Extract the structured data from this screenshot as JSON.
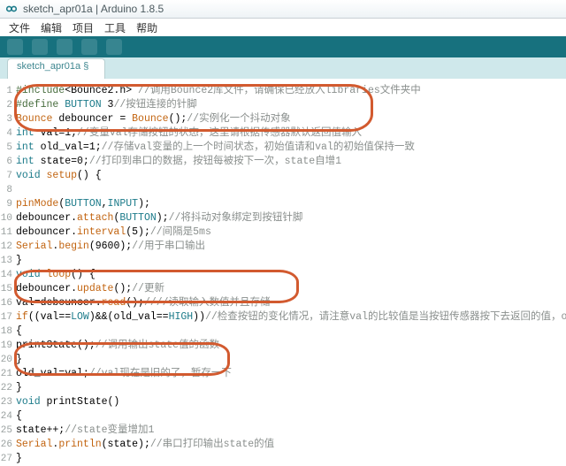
{
  "window": {
    "title": "sketch_apr01a | Arduino 1.8.5"
  },
  "menu": {
    "file": "文件",
    "edit": "编辑",
    "project": "项目",
    "tools": "工具",
    "help": "帮助"
  },
  "tabs": {
    "main": "sketch_apr01a §"
  },
  "code": {
    "lines": [
      {
        "n": "1",
        "html": "<span class='kw-inc'>#include</span>&lt;Bounce2.h&gt; <span class='cmt'>//调用Bounce2库文件，请确保已经放入libraries文件夹中</span>"
      },
      {
        "n": "2",
        "html": "<span class='kw-def'>#define</span> <span class='mac'>BUTTON</span> 3<span class='cmt'>//按钮连接的针脚</span>"
      },
      {
        "n": "3",
        "html": "<span class='cls'>Bounce</span> debouncer = <span class='cls'>Bounce</span>();<span class='cmt'>//实例化一个抖动对象</span>"
      },
      {
        "n": "4",
        "html": "<span class='kw-type'>int</span> val=1;<span class='cmt'>//变量val存储按钮的状态，这里请根据传感器默认返回值输入</span>"
      },
      {
        "n": "5",
        "html": "<span class='kw-type'>int</span> old_val=1;<span class='cmt'>//存储val变量的上一个时间状态，初始值请和val的初始值保持一致</span>"
      },
      {
        "n": "6",
        "html": "<span class='kw-type'>int</span> state=0;<span class='cmt'>//打印到串口的数据，按钮每被按下一次，state自增1</span>"
      },
      {
        "n": "7",
        "html": "<span class='kw-void'>void</span> <span class='fn'>setup</span>() {"
      },
      {
        "n": "8",
        "html": ""
      },
      {
        "n": "9",
        "html": "<span class='fn'>pinMode</span>(<span class='mac'>BUTTON</span>,<span class='mac'>INPUT</span>);"
      },
      {
        "n": "10",
        "html": "debouncer.<span class='fn'>attach</span>(<span class='mac'>BUTTON</span>);<span class='cmt'>//将抖动对象绑定到按钮针脚</span>"
      },
      {
        "n": "11",
        "html": "debouncer.<span class='fn'>interval</span>(5);<span class='cmt'>//间隔是5ms</span>"
      },
      {
        "n": "12",
        "html": "<span class='cls'>Serial</span>.<span class='fn'>begin</span>(9600);<span class='cmt'>//用于串口输出</span>"
      },
      {
        "n": "13",
        "html": "}"
      },
      {
        "n": "14",
        "html": "<span class='kw-void'>void</span> <span class='fn'>loop</span>() {"
      },
      {
        "n": "15",
        "html": "debouncer.<span class='fn'>update</span>();<span class='cmt'>//更新</span>"
      },
      {
        "n": "16",
        "html": "val=debouncer.<span class='fn'>read</span>();<span class='cmt'>////读取输入数值并且存储</span>"
      },
      {
        "n": "17",
        "html": "<span class='fn'>if</span>((val==<span class='mac'>LOW</span>)&&(old_val==<span class='mac'>HIGH</span>))<span class='cmt'>//检查按钮的变化情况，请注意val的比较值是当按钮传感器按下去返回的值，old_val和val相反即可。</span>"
      },
      {
        "n": "18",
        "html": "{"
      },
      {
        "n": "19",
        "html": "printState();<span class='cmt'>//调用输出state值的函数</span>"
      },
      {
        "n": "20",
        "html": "}"
      },
      {
        "n": "21",
        "html": "old_val=val;<span class='cmt'>//val现在是旧的了，暂存一下</span>"
      },
      {
        "n": "22",
        "html": "}"
      },
      {
        "n": "23",
        "html": "<span class='kw-void'>void</span> printState()"
      },
      {
        "n": "24",
        "html": "{"
      },
      {
        "n": "25",
        "html": "state++;<span class='cmt'>//state变量增加1</span>"
      },
      {
        "n": "26",
        "html": "<span class='cls'>Serial</span>.<span class='fn'>println</span>(state);<span class='cmt'>//串口打印输出state的值</span>"
      },
      {
        "n": "27",
        "html": "}"
      }
    ]
  }
}
